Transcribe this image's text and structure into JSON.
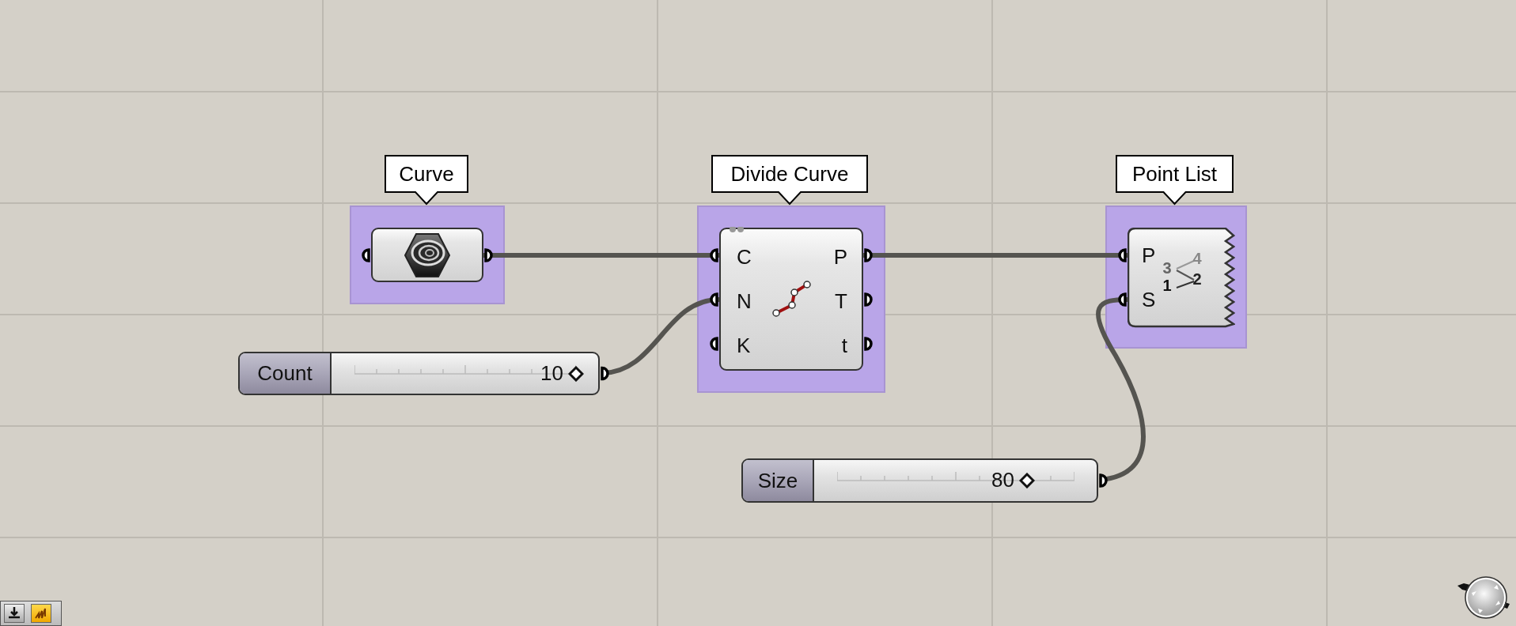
{
  "components": [
    {
      "kind": "param",
      "tooltip": "Curve"
    },
    {
      "kind": "component",
      "tooltip": "Divide Curve",
      "inputs": [
        "C",
        "N",
        "K"
      ],
      "outputs": [
        "P",
        "T",
        "t"
      ]
    },
    {
      "kind": "list",
      "tooltip": "Point List",
      "inputs": [
        "P",
        "S"
      ],
      "icon_labels": [
        "3",
        "4",
        "1",
        "2"
      ]
    }
  ],
  "sliders": [
    {
      "label": "Count",
      "value": "10",
      "level": 1.0
    },
    {
      "label": "Size",
      "value": "80",
      "level": 0.8
    }
  ]
}
